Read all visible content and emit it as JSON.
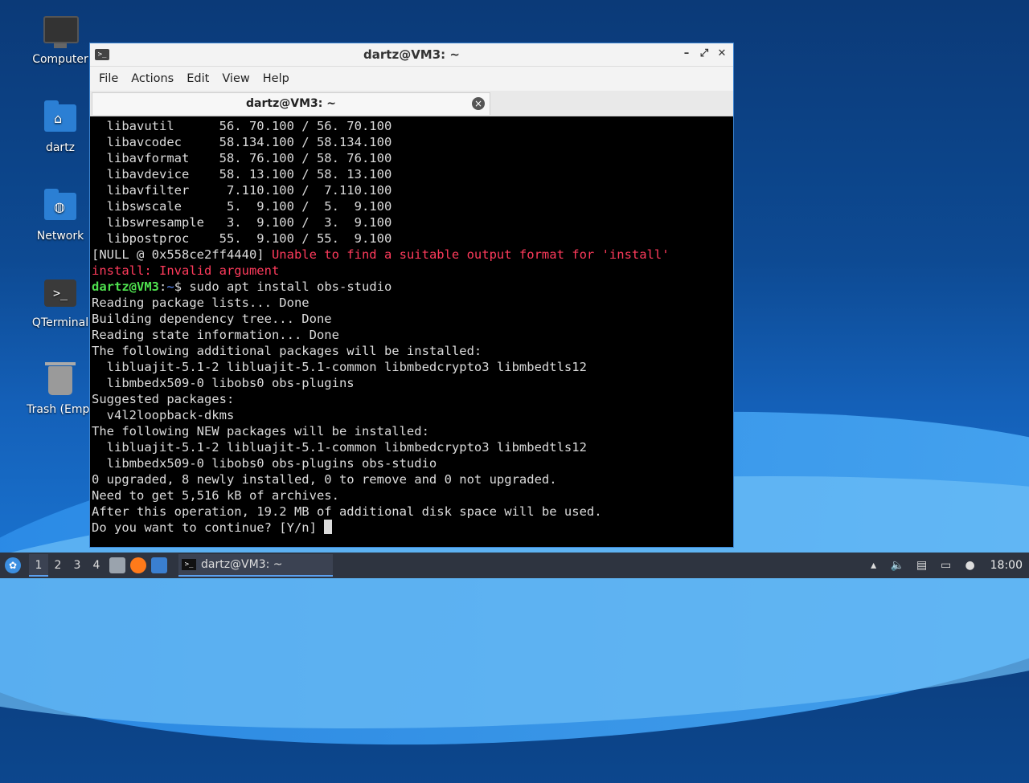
{
  "desktop": {
    "icons": [
      {
        "label": "Computer"
      },
      {
        "label": "dartz"
      },
      {
        "label": "Network"
      },
      {
        "label": "QTerminal"
      },
      {
        "label": "Trash (Empt"
      }
    ]
  },
  "window": {
    "title": "dartz@VM3: ~",
    "menu": [
      "File",
      "Actions",
      "Edit",
      "View",
      "Help"
    ],
    "tab_label": "dartz@VM3: ~"
  },
  "terminal": {
    "lines": [
      "  libavutil      56. 70.100 / 56. 70.100",
      "  libavcodec     58.134.100 / 58.134.100",
      "  libavformat    58. 76.100 / 58. 76.100",
      "  libavdevice    58. 13.100 / 58. 13.100",
      "  libavfilter     7.110.100 /  7.110.100",
      "  libswscale      5.  9.100 /  5.  9.100",
      "  libswresample   3.  9.100 /  3.  9.100",
      "  libpostproc    55.  9.100 / 55.  9.100"
    ],
    "null_prefix": "[NULL @ 0x558ce2ff4440]",
    "null_error": " Unable to find a suitable output format for 'install'",
    "install_error": "install: Invalid argument",
    "prompt_user": "dartz@VM3",
    "prompt_sep": ":",
    "prompt_dir": "~",
    "prompt_cmd": "$ sudo apt install obs-studio",
    "output": [
      "Reading package lists... Done",
      "Building dependency tree... Done",
      "Reading state information... Done",
      "The following additional packages will be installed:",
      "  libluajit-5.1-2 libluajit-5.1-common libmbedcrypto3 libmbedtls12",
      "  libmbedx509-0 libobs0 obs-plugins",
      "Suggested packages:",
      "  v4l2loopback-dkms",
      "The following NEW packages will be installed:",
      "  libluajit-5.1-2 libluajit-5.1-common libmbedcrypto3 libmbedtls12",
      "  libmbedx509-0 libobs0 obs-plugins obs-studio",
      "0 upgraded, 8 newly installed, 0 to remove and 0 not upgraded.",
      "Need to get 5,516 kB of archives.",
      "After this operation, 19.2 MB of additional disk space will be used."
    ],
    "final_prompt": "Do you want to continue? [Y/n] "
  },
  "taskbar": {
    "workspaces": [
      "1",
      "2",
      "3",
      "4"
    ],
    "task_label": "dartz@VM3: ~",
    "clock": "18:00"
  }
}
